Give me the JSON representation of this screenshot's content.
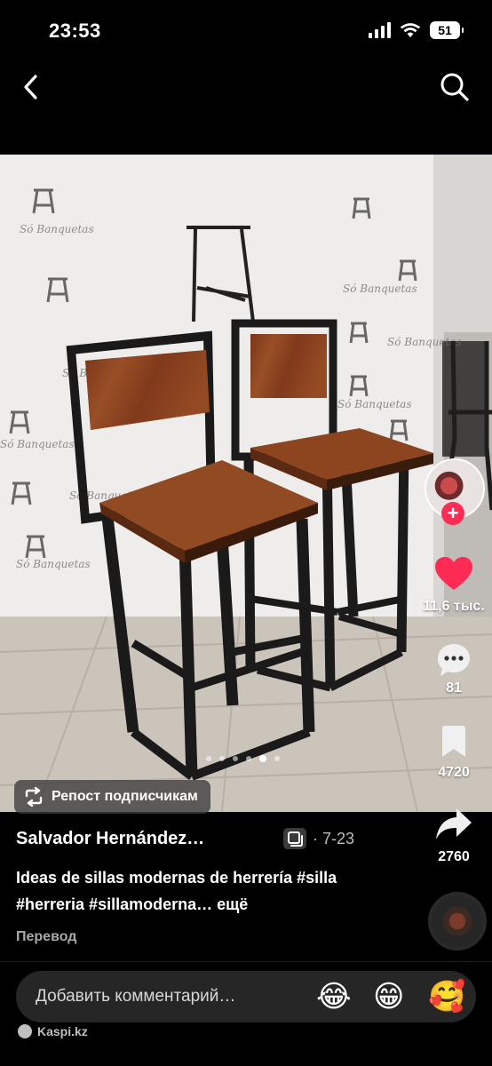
{
  "status_bar": {
    "time": "23:53",
    "battery": "51"
  },
  "photo": {
    "wall_brand_text": "Só Banquetas",
    "chairs": 2,
    "carousel_dots": 6,
    "active_dot": 5
  },
  "repost_chip": {
    "label": "Репост подписчикам"
  },
  "right_rail": {
    "likes": "11,6 тыс.",
    "comments": "81",
    "saves": "4720",
    "shares": "2760"
  },
  "caption": {
    "author": "Salvador Hernández…",
    "date": "· 7-23",
    "text": "Ideas de sillas modernas de herrería #silla #herreria #sillamoderna…",
    "more": " ещё",
    "translate": "Перевод"
  },
  "comment_bar": {
    "placeholder": "Добавить комментарий…",
    "emojis": [
      "😂",
      "😁",
      "🥰"
    ]
  },
  "watermark": {
    "text": "Kaspi.kz"
  },
  "colors": {
    "accent": "#fe2c55",
    "background": "#000000",
    "comment_bar": "#262626"
  },
  "icons": [
    "signal-icon",
    "wifi-icon",
    "battery-icon",
    "back-arrow-icon",
    "search-icon",
    "heart-icon",
    "comment-icon",
    "bookmark-icon",
    "share-icon",
    "repost-icon",
    "gallery-icon"
  ]
}
